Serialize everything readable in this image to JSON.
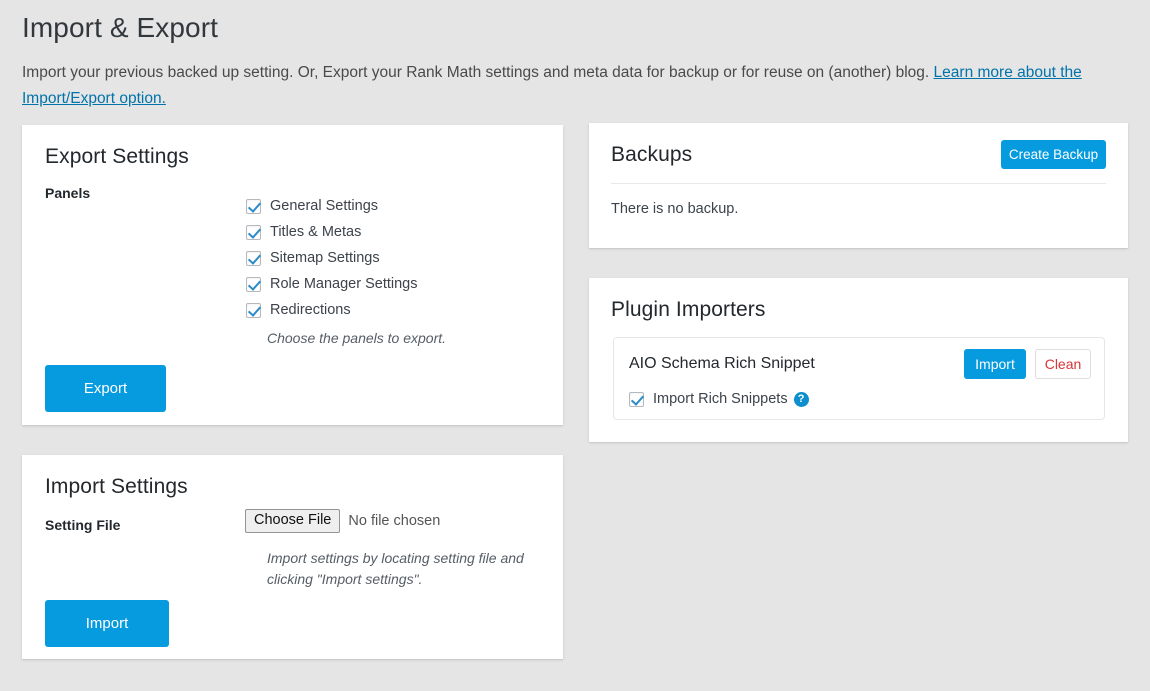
{
  "header": {
    "title": "Import & Export",
    "description_part1": "Import your previous backed up setting. Or, Export your Rank Math settings and meta data for backup or for reuse on (another) blog. ",
    "link_text": "Learn more about the Import/Export option.",
    "link_color": "#0073aa"
  },
  "export_card": {
    "title": "Export Settings",
    "panels_label": "Panels",
    "panels": [
      {
        "label": "General Settings",
        "checked": true
      },
      {
        "label": "Titles & Metas",
        "checked": true
      },
      {
        "label": "Sitemap Settings",
        "checked": true
      },
      {
        "label": "Role Manager Settings",
        "checked": true
      },
      {
        "label": "Redirections",
        "checked": true
      }
    ],
    "hint": "Choose the panels to export.",
    "export_button": "Export"
  },
  "import_card": {
    "title": "Import Settings",
    "setting_file_label": "Setting File",
    "choose_file_button": "Choose File",
    "file_status": "No file chosen",
    "hint": "Import settings by locating setting file and clicking \"Import settings\".",
    "import_button": "Import"
  },
  "backups_card": {
    "title": "Backups",
    "create_backup_button": "Create Backup",
    "empty_message": "There is no backup."
  },
  "plugin_importers_card": {
    "title": "Plugin Importers",
    "importers": [
      {
        "name": "AIO Schema Rich Snippet",
        "import_button": "Import",
        "clean_button": "Clean",
        "option_label": "Import Rich Snippets",
        "option_checked": true,
        "help_icon": "question-mark-icon"
      }
    ]
  },
  "colors": {
    "page_background": "#e5e5e5",
    "card_background": "#ffffff",
    "primary_button": "#069ade",
    "link": "#0073aa",
    "danger_text": "#d63638",
    "checkmark": "#2b8bc6",
    "help_icon": "#0d8ecf"
  }
}
